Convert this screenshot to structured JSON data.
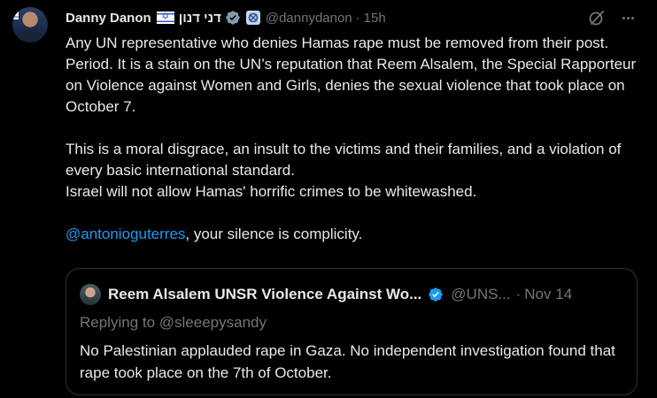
{
  "author": {
    "name": "Danny Danon",
    "hebrew_name": "דני דנון",
    "handle": "@dannydanon",
    "separator": "·",
    "time": "15h"
  },
  "body": {
    "paragraph1": "Any UN representative who denies Hamas rape must be removed from their post. Period. It is a stain on the UN’s reputation that Reem Alsalem, the Special Rapporteur on Violence against Women and Girls, denies the sexual violence that took place on October 7.",
    "paragraph2_line1": "This is a moral disgrace, an insult to the victims and their families, and a violation of every basic international standard.",
    "paragraph2_line2": "Israel will not allow Hamas' horrific crimes to be whitewashed.",
    "mention": "@antonioguterres",
    "mention_tail": ", your silence is complicity."
  },
  "quoted": {
    "name": "Reem Alsalem UNSR Violence Against Wo...",
    "handle": "@UNS...",
    "separator": "·",
    "time": "Nov 14",
    "replying_to": "Replying to @sleeepysandy",
    "text": "No Palestinian applauded rape in Gaza. No independent investigation found that rape took place on the 7th of October."
  },
  "icons": {
    "verified": "verified-badge-icon",
    "affiliation": "government-affiliation-icon",
    "grok": "grok-icon",
    "more": "more-options-icon",
    "flag": "israel-flag-emoji"
  },
  "colors": {
    "background": "#000000",
    "text": "#e7e9ea",
    "secondary": "#71767b",
    "link": "#1d9bf0",
    "verified_gray": "#829aab",
    "verified_blue": "#1d9bf0",
    "border": "#2f3336"
  }
}
